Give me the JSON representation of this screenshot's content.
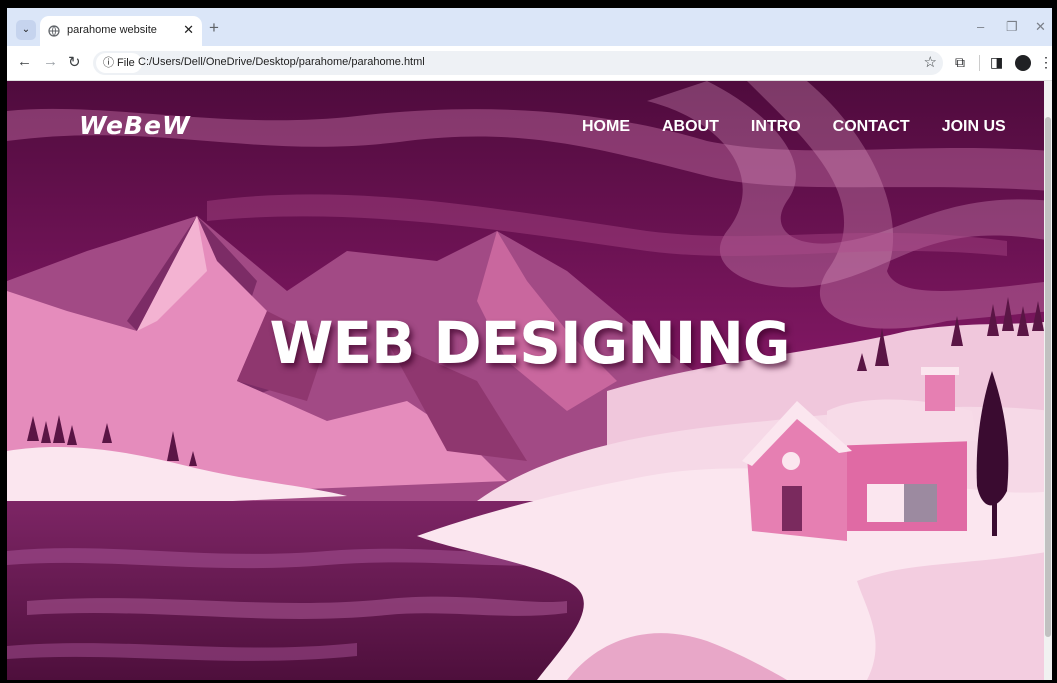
{
  "browser": {
    "tab_title": "parahome website",
    "tab_close": "✕",
    "new_tab": "+",
    "chip_label": "ⓘ File",
    "url": "C:/Users/Dell/OneDrive/Desktop/parahome/parahome.html",
    "window_controls": [
      "–",
      "❐",
      "✕"
    ]
  },
  "site": {
    "logo": "WeBeW",
    "nav": [
      "HOME",
      "ABOUT",
      "INTRO",
      "CONTACT",
      "JOIN US"
    ],
    "hero_title": "WEB DESIGNING"
  },
  "colors": {
    "sky_top": "#4f0b3d",
    "sky_mid": "#8c1a6a",
    "mountain_light": "#e58cbc",
    "mountain_dark": "#a24a85",
    "snow": "#fbe6ef",
    "water": "#6b1c55",
    "house": "#e06aa4"
  }
}
